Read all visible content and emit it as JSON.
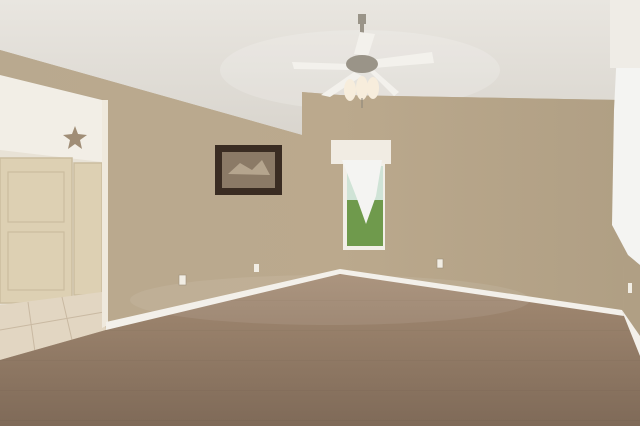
{
  "scene": {
    "subject": "empty-room-interior",
    "colors": {
      "ceiling": "#e9e6e0",
      "ceiling_shadow": "#d9d5ce",
      "wall_left": "#b9a98f",
      "wall_back": "#bba98d",
      "wall_right": "#b09f84",
      "floor_light": "#a58c74",
      "floor_dark": "#7f6a58",
      "baseboard": "#f3f0ea",
      "door": "#ddd0b3",
      "door_frame": "#efe9dd",
      "hall_wall": "#f2eee6",
      "tile_floor": "#e2d6c2",
      "window_glass": "#cfe3d6",
      "window_greenery": "#6f9a4c",
      "curtain": "#f4f4f2",
      "valance": "#f1ece3",
      "picture_frame": "#3a2c22",
      "picture_art": "#8b7a66",
      "fan_metal": "#9a9488",
      "fan_blade": "#f3f1ec",
      "fan_glass": "#f7eddc"
    }
  }
}
